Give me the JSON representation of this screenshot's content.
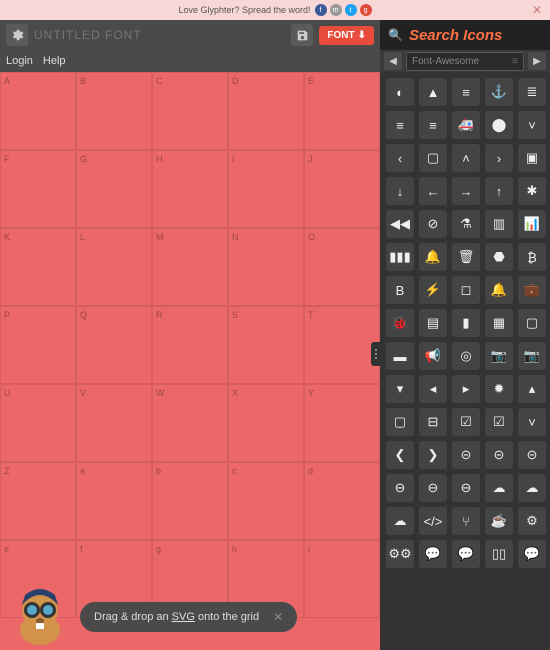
{
  "banner": {
    "text": "Love Glyphter? Spread the word!"
  },
  "toolbar": {
    "title_placeholder": "UNTITLED FONT",
    "font_label": "FONT"
  },
  "subbar": {
    "login": "Login",
    "help": "Help"
  },
  "grid_letters": [
    "A",
    "B",
    "C",
    "D",
    "E",
    "F",
    "G",
    "H",
    "I",
    "J",
    "K",
    "L",
    "M",
    "N",
    "O",
    "P",
    "Q",
    "R",
    "S",
    "T",
    "U",
    "V",
    "W",
    "X",
    "Y",
    "Z",
    "a",
    "b",
    "c",
    "d",
    "e",
    "f",
    "g",
    "h",
    "i"
  ],
  "tooltip": {
    "pre": "Drag & drop an ",
    "mid": "SVG",
    "post": " onto the grid"
  },
  "search": {
    "title": "Search Icons"
  },
  "iconset": {
    "selected": "Font-Awesome"
  },
  "icons": [
    "adjust",
    "adn",
    "align-center",
    "anchor",
    "align-justify",
    "align-left",
    "align-right",
    "ambulance",
    "android",
    "angle-down",
    "angle-left",
    "apple",
    "angle-up",
    "angle-right",
    "archive",
    "arrow-down",
    "arrow-left",
    "arrow-right",
    "arrow-up",
    "asterisk",
    "backward",
    "ban",
    "flask",
    "bar-chart",
    "bar-chart-o",
    "barcode",
    "bell-o",
    "trash",
    "bitbucket",
    "btc",
    "bold",
    "bolt",
    "bookmark-o",
    "bell",
    "briefcase",
    "bug",
    "book",
    "bookmark",
    "calendar",
    "calendar-o",
    "building",
    "bullhorn",
    "bullseye",
    "camera-retro",
    "camera",
    "caret-down",
    "caret-left",
    "caret-right",
    "certificate",
    "caret-up",
    "square-o",
    "minus-square-o",
    "check-square",
    "check-square-o",
    "chevron-down",
    "chevron-left",
    "chevron-right",
    "chevron-circle-down",
    "chevron-circle-left",
    "chevron-circle-right",
    "circle-down",
    "circle-left",
    "circle-right",
    "cloud-download",
    "cloud-upload",
    "cloud",
    "code",
    "code-fork",
    "coffee",
    "cog",
    "cogs",
    "comment-o",
    "comments-o",
    "columns",
    "comment"
  ]
}
